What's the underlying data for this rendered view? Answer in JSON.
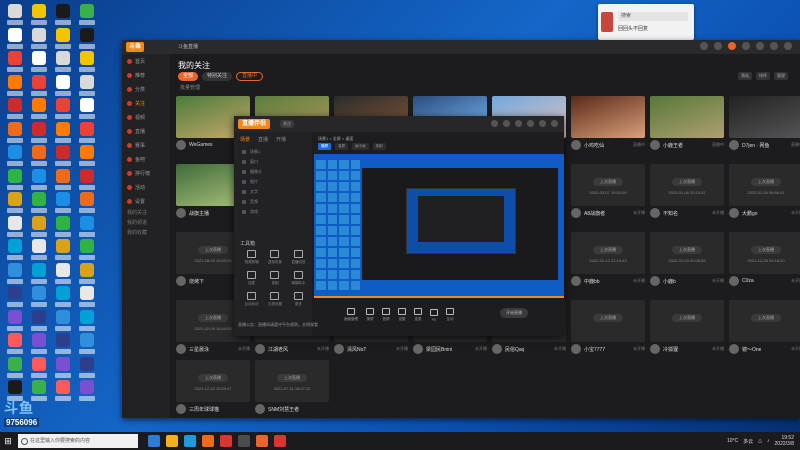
{
  "desktop": {
    "icon_colors": [
      "#d9d9d9",
      "#2f8fdc",
      "#cc2b2b",
      "#3ab04a",
      "#d9a21b",
      "#ffffff",
      "#2c3e8c",
      "#ef6b1a",
      "#1a1a1a",
      "#e8e8e8",
      "#ea4335",
      "#7b4fd1",
      "#1a8fe3",
      "#f3c400",
      "#00a1d6",
      "#ff7a00",
      "#ff5a5a",
      "#2fb344"
    ]
  },
  "qq_popup": {
    "search_placeholder": "搜索",
    "line": "回回头不回复"
  },
  "main_window": {
    "logo": "斗鱼",
    "title_text": "斗鱼直播",
    "sidebar": {
      "items": [
        {
          "label": "首页"
        },
        {
          "label": "推荐"
        },
        {
          "label": "分类"
        },
        {
          "label": "关注"
        },
        {
          "label": "视频"
        },
        {
          "label": "直播"
        },
        {
          "label": "赛事"
        },
        {
          "label": "鱼吧"
        },
        {
          "label": "排行榜"
        },
        {
          "label": "活动"
        },
        {
          "label": "设置"
        }
      ],
      "sections": [
        "我的关注",
        "我的频道",
        "我的收藏"
      ]
    },
    "page_title": "我的关注",
    "tabs": [
      "全部",
      "特别关注",
      "直播中"
    ],
    "batch_label": "批量管理",
    "right_tools": [
      "筛选",
      "排序",
      "管理"
    ],
    "offline_badge": "上次直播",
    "cards": [
      {
        "name": "WeGames",
        "status": "直播中",
        "kind": "live",
        "c1": "#4b7b3a",
        "c2": "#c7a96a"
      },
      {
        "name": "",
        "status": "",
        "kind": "live",
        "c1": "#5a7e3b",
        "c2": "#b59a5e"
      },
      {
        "name": "",
        "status": "",
        "kind": "live",
        "c1": "#2b2b2b",
        "c2": "#8b5a3a"
      },
      {
        "name": "",
        "status": "",
        "kind": "live",
        "c1": "#2a4b7d",
        "c2": "#7ec0ff"
      },
      {
        "name": "",
        "status": "",
        "kind": "live",
        "c1": "#6fa7de",
        "c2": "#e8c6c0"
      },
      {
        "name": "小鸡吃仙",
        "status": "直播中",
        "kind": "live",
        "c1": "#5a2a1a",
        "c2": "#d9a07a"
      },
      {
        "name": "小鹿王者",
        "status": "直播中",
        "kind": "live",
        "c1": "#56783a",
        "c2": "#b0a070"
      },
      {
        "name": "D7jen · 网鱼",
        "status": "直播中",
        "kind": "live",
        "c1": "#222",
        "c2": "#555"
      },
      {
        "name": "战旗主播",
        "status": "直播中",
        "kind": "live",
        "c1": "#3f6a3a",
        "c2": "#a9c27a"
      },
      {
        "name": "A8战旗者",
        "status": "未开播",
        "kind": "off",
        "ts": "2022-03-07 19:52:09"
      },
      {
        "name": "不知名",
        "status": "未开播",
        "kind": "off",
        "ts": "2022-01-06 20:13:37"
      },
      {
        "name": "大鹏go",
        "status": "未开播",
        "kind": "off",
        "ts": "2022-01-26 08:56:41"
      },
      {
        "name": "烧烤下",
        "status": "未开播",
        "kind": "off",
        "ts": "2021-08-05 10:53:00"
      },
      {
        "name": "中鹿bb",
        "status": "未开播",
        "kind": "off",
        "ts": "2022-02-12 21:18:43"
      },
      {
        "name": "小鹿b",
        "status": "未开播",
        "kind": "off",
        "ts": "2022-02-03 20:06:52"
      },
      {
        "name": "C0za",
        "status": "未开播",
        "kind": "off",
        "ts": "2021-12-28 04:18:20"
      },
      {
        "name": "三星晨泳",
        "status": "未开播",
        "kind": "off",
        "ts": "2021-02-09 18:44:00"
      },
      {
        "name": "江湖老风",
        "status": "未开播",
        "kind": "off",
        "ts": ""
      },
      {
        "name": "清风NoT",
        "status": "未开播",
        "kind": "off",
        "ts": ""
      },
      {
        "name": "梁园民Bnini",
        "status": "未开播",
        "kind": "off",
        "ts": ""
      },
      {
        "name": "民俗Qaq",
        "status": "未开播",
        "kind": "off",
        "ts": ""
      },
      {
        "name": "小宝7777",
        "status": "未开播",
        "kind": "off",
        "ts": ""
      },
      {
        "name": "冷狐狸",
        "status": "未开播",
        "kind": "off",
        "ts": ""
      },
      {
        "name": "镜～One",
        "status": "未开播",
        "kind": "off",
        "ts": ""
      },
      {
        "name": "",
        "status": "",
        "kind": "off",
        "ts": "2021-12-22 15:59:47"
      },
      {
        "name": "",
        "status": "",
        "kind": "off",
        "ts": "2021-07-11 18:07:22"
      },
      {
        "name": "三周年球球猫",
        "status": "",
        "kind": "plain"
      },
      {
        "name": "SNM刘慧王者",
        "status": "",
        "kind": "plain"
      }
    ]
  },
  "nested_window": {
    "logo": "直播伴侣",
    "badge": "关注",
    "side_tabs": [
      "场景",
      "直播",
      "开播"
    ],
    "side_rows": [
      "场景1",
      "窗口",
      "摄像头",
      "图片",
      "文字",
      "音频",
      "游戏"
    ],
    "tools_title": "工具箱",
    "tools": [
      "视频剪辑",
      "虚拟形象",
      "直播回放",
      "连麦",
      "录制",
      "弹幕助手",
      "互动玩法",
      "礼物设置",
      "更多"
    ],
    "notice": "直播公告：直播间请遵守平台规则，文明观看",
    "path": "场景1 > 全屏 > 桌面",
    "subtabs": [
      "横屏",
      "竖屏",
      "画中画",
      "录制"
    ],
    "bottom_items": [
      "画面管理",
      "美颜",
      "音频",
      "设置",
      "连麦",
      "PK",
      "互动"
    ],
    "start_label": "开始直播"
  },
  "watermark": {
    "logo": "斗鱼",
    "number": "9756096"
  },
  "taskbar": {
    "start_icon": "windows-logo",
    "search_placeholder": "在这里输入你要搜索的内容",
    "app_colors": [
      "#2d7cd6",
      "#f2b21b",
      "#1e9ae0",
      "#ef6b1a",
      "#d33",
      "#4c4c4c",
      "#e8662a",
      "#d33"
    ],
    "weather": "10°C",
    "weather_desc": "多云",
    "time": "19:52",
    "date": "2022/3/8"
  }
}
